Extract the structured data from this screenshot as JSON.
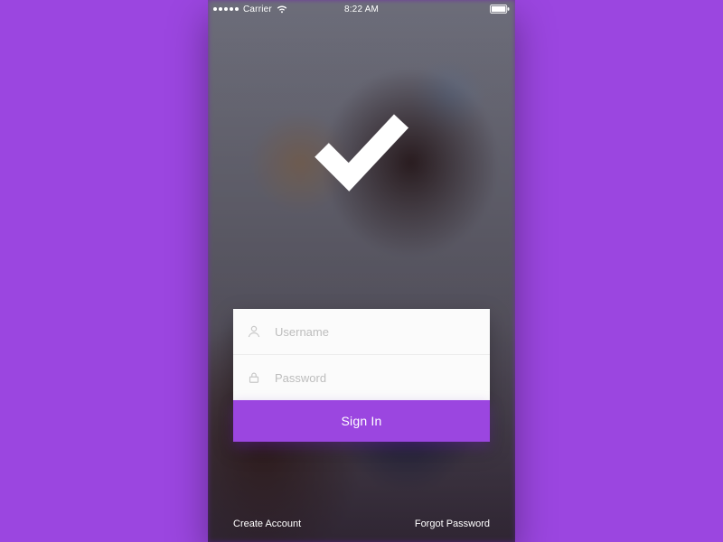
{
  "status_bar": {
    "carrier": "Carrier",
    "time": "8:22 AM"
  },
  "logo": {
    "name": "checkmark-icon"
  },
  "form": {
    "username": {
      "placeholder": "Username",
      "value": "",
      "icon": "user-icon"
    },
    "password": {
      "placeholder": "Password",
      "value": "",
      "icon": "lock-icon"
    }
  },
  "signin_label": "Sign In",
  "footer": {
    "create": "Create Account",
    "forgot": "Forgot Password"
  },
  "colors": {
    "accent": "#9b46e0"
  }
}
